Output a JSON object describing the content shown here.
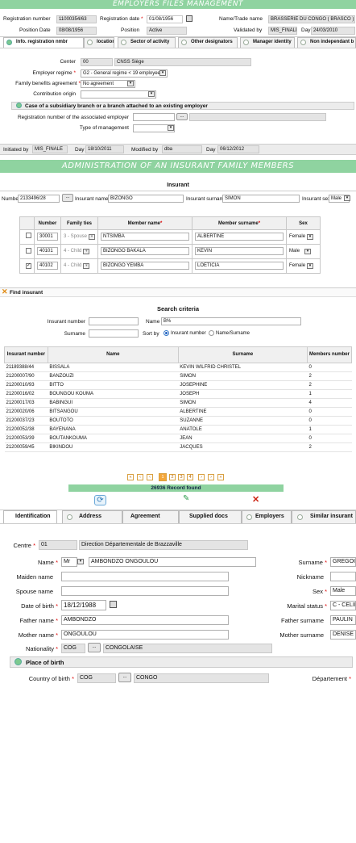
{
  "emp": {
    "title": "EMPLOYERS FILES MANAGEMENT",
    "reg_no_label": "Registration number",
    "reg_no": "11000354/63",
    "reg_date_label": "Registration date",
    "reg_date": "01/08/1956",
    "name_label": "Name/Trade name",
    "name": "BRASSERIE DU CONGO ( BRASCO )",
    "pos_date_label": "Position Date",
    "pos_date": "08/08/1956",
    "position_label": "Position",
    "position": "Active",
    "validated_label": "Validated by",
    "validated": "MIS_FINALE",
    "day_label": "Day",
    "day": "24/03/2010",
    "tabs": [
      "Info. registration nmbr",
      "location",
      "Sector of activity",
      "Other designators",
      "Manager identity",
      "Non independant b"
    ],
    "center_label": "Center",
    "center_code": "00",
    "center_name": "CNSS Siège",
    "regime_label": "Employer regime",
    "regime": "G2 - General regime < 19 employees",
    "family_label": "Family benefits agreement",
    "family": "No agreement",
    "contrib_label": "Contribution origin",
    "subsidiary_title": "Case of a subsidiary branch or a branch attached to an existing employer",
    "assoc_label": "Registration number of the associated employer",
    "mgmt_label": "Type of management",
    "initiated_label": "Initiated by",
    "initiated": "MIS_FINALE",
    "day1_label": "Day",
    "day1": "18/10/2011",
    "modified_label": "Modified by",
    "modified": "dba",
    "day2_label": "Day",
    "day2": "06/12/2012"
  },
  "fam": {
    "title": "ADMINISTRATION OF AN INSURANT FAMILY MEMBERS",
    "section": "Insurant",
    "number_label": "Number",
    "number": "2133496/28",
    "name_label": "Insurant name",
    "name": "BIZONGO",
    "surname_label": "Insurant surname",
    "surname": "SIMON",
    "sex_label": "Insurant sex",
    "sex": "Male",
    "headers": [
      "Number",
      "Family ties",
      "Member name",
      "Member surname",
      "Sex"
    ],
    "rows": [
      {
        "number": "30001",
        "ties": "3 - Spouse",
        "name": "NTSIMBA",
        "surname": "ALBERTINE",
        "sex": "Female",
        "checked": false
      },
      {
        "number": "40101",
        "ties": "4 - Child",
        "name": "BIZONGO BAKALA",
        "surname": "KEVIN",
        "sex": "Male",
        "checked": false
      },
      {
        "number": "40102",
        "ties": "4 - Child",
        "name": "BIZONGO YEMBA",
        "surname": "LOETICIA",
        "sex": "Female",
        "checked": true
      }
    ]
  },
  "find": {
    "title": "Find insurant",
    "criteria": "Search criteria",
    "ins_num_label": "Insurant number",
    "ins_num": "",
    "name_label": "Name",
    "name": "B%",
    "surname_label": "Surname",
    "surname": "",
    "sort_label": "Sort by",
    "sort_opt1": "Insurant number",
    "sort_opt2": "Name/Surname",
    "headers": [
      "Insurant number",
      "Name",
      "Surname",
      "Members number"
    ],
    "rows": [
      [
        "21189388/44",
        "BISSALA",
        "KEVIN WILFRID CHRISTEL",
        "0"
      ],
      [
        "21200007/90",
        "BANZOUZI",
        "SIMON",
        "2"
      ],
      [
        "21200010/93",
        "BITTO",
        "JOSEPHINE",
        "2"
      ],
      [
        "21200016/02",
        "BOUNGOU KOUMA",
        "JOSEPH",
        "1"
      ],
      [
        "21200017/03",
        "BABINGUI",
        "SIMON",
        "4"
      ],
      [
        "21200020/06",
        "BITSANGOU",
        "ALBERTINE",
        "0"
      ],
      [
        "21200037/23",
        "BOUTOTO",
        "SUZANNE",
        "0"
      ],
      [
        "21200052/38",
        "BAYENANA",
        "ANATOLE",
        "1"
      ],
      [
        "21200053/39",
        "BOUTANKOUMA",
        "JEAN",
        "0"
      ],
      [
        "21200059/45",
        "BIKINDOU",
        "JACQUES",
        "2"
      ]
    ],
    "pages": [
      "1",
      "2",
      "3",
      "4"
    ],
    "records": "26936 Record found"
  },
  "ident": {
    "tabs": [
      "Identification",
      "Address",
      "Agreement",
      "Supplied docs",
      "Employers",
      "Similar insurant"
    ],
    "centre_label": "Centre",
    "centre_code": "01",
    "centre_name": "Direction Départementale de Brazzaville",
    "name_label": "Name",
    "title": "Mr",
    "name": "AMBONDZO ONGOULOU",
    "surname_label": "Surname",
    "surname": "GREGOIRE",
    "maiden_label": "Maiden name",
    "nick_label": "Nickname",
    "spouse_label": "Spouse name",
    "sex_label": "Sex",
    "sex": "Male",
    "dob_label": "Date of birth",
    "dob": "18/12/1988",
    "marital_label": "Marital status",
    "marital": "C - CELIB",
    "father_label": "Father name",
    "father": "AMBONDZO",
    "father_sur_label": "Father surname",
    "father_sur": "PAULIN",
    "mother_label": "Mother name",
    "mother": "ONGOULOU",
    "mother_sur_label": "Mother surname",
    "mother_sur": "DENISE",
    "nat_label": "Nationality",
    "nat_code": "COG",
    "nat_name": "CONGOLAISE",
    "pob_title": "Place of birth",
    "country_label": "Country of birth",
    "country_code": "COG",
    "country_name": "CONGO",
    "dept_label": "Département"
  }
}
